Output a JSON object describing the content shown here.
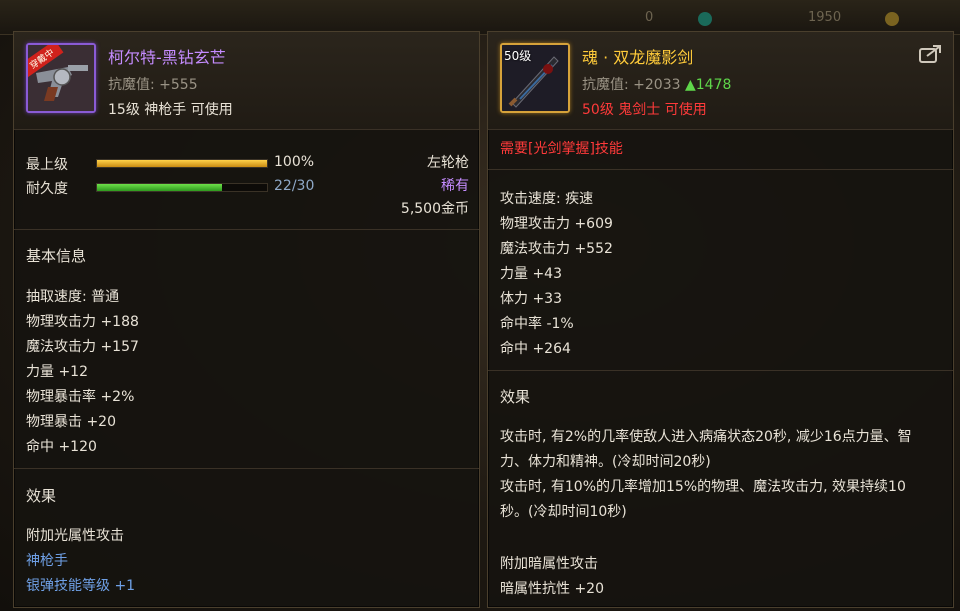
{
  "colors": {
    "rare_purple": "#c58cff",
    "legend_gold": "#ffcb3a",
    "requirement_red": "#ff3a3a",
    "link_blue": "#6fa0e6",
    "buff_green": "#5fd64a"
  },
  "background": {
    "currency_a": "0",
    "currency_b": "1950"
  },
  "left_item": {
    "badge": "穿戴中",
    "icon": "revolver-icon",
    "name": "柯尔特-黑钻玄芒",
    "magic_resist": "抗魔值: +555",
    "requirement": "15级 神枪手 可使用",
    "grade_label": "最上级",
    "grade_value": "100%",
    "grade_fraction": 1.0,
    "durability_label": "耐久度",
    "durability_value": "22/30",
    "durability_fraction": 0.733,
    "weapon_type": "左轮枪",
    "rarity": "稀有",
    "price": "5,500金币",
    "basic_info_title": "基本信息",
    "stats": [
      "抽取速度: 普通",
      "物理攻击力 +188",
      "魔法攻击力 +157",
      "力量 +12",
      "物理暴击率 +2%",
      "物理暴击 +20",
      "命中 +120"
    ],
    "effects_title": "效果",
    "effect_line": "附加光属性攻击",
    "effect_class": "神枪手",
    "effect_skill": "银弹技能等级 +1"
  },
  "right_item": {
    "level_badge": "50级",
    "icon": "sword-icon",
    "name": "魂 · 双龙魔影剑",
    "magic_resist": "抗魔值: +2033",
    "magic_resist_delta": "▲1478",
    "requirement": "50级 鬼剑士 可使用",
    "skill_requirement": "需要[光剑掌握]技能",
    "stats": [
      "攻击速度: 疾速",
      "物理攻击力 +609",
      "魔法攻击力 +552",
      "力量 +43",
      "体力 +33",
      "命中率 -1%",
      "命中 +264"
    ],
    "effects_title": "效果",
    "effect_para_1": "攻击时, 有2%的几率使敌人进入病痛状态20秒, 减少16点力量、智力、体力和精神。(冷却时间20秒)",
    "effect_para_2": "攻击时, 有10%的几率增加15%的物理、魔法攻击力, 效果持续10秒。(冷却时间10秒)",
    "extra_line_1": "附加暗属性攻击",
    "extra_line_2": "暗属性抗性 +20",
    "share_icon": "share-icon"
  }
}
